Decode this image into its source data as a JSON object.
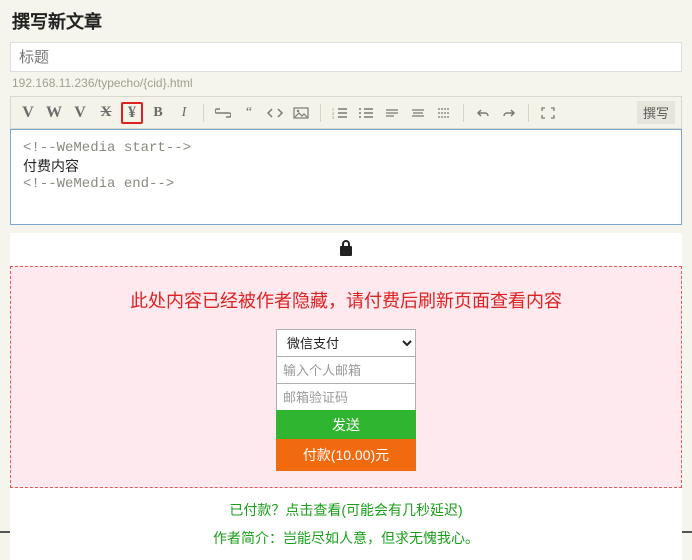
{
  "page": {
    "title": "撰写新文章"
  },
  "title_field": {
    "placeholder": "标题"
  },
  "permalink": "192.168.11.236/typecho/{cid}.html",
  "toolbar": {
    "v_btn": "V",
    "w_btn": "W",
    "v2_btn": "V",
    "x_btn": "X",
    "yen_btn": "¥",
    "bold_btn": "B",
    "italic_btn": "I",
    "quote_btn": "“",
    "right_btn": "撰写"
  },
  "editor": {
    "line1": "<!--WeMedia start-->",
    "line2": "付费内容",
    "line3": "<!--WeMedia end-->"
  },
  "paywall": {
    "message": "此处内容已经被作者隐藏，请付费后刷新页面查看内容",
    "method": "微信支付",
    "email_placeholder": "输入个人邮箱",
    "code_placeholder": "邮箱验证码",
    "send_btn": "发送",
    "pay_btn": "付款(10.00)元",
    "paid_link": "已付款？点击查看(可能会有几秒延迟)",
    "author_line": "作者简介：岂能尽如人意，但求无愧我心。"
  }
}
